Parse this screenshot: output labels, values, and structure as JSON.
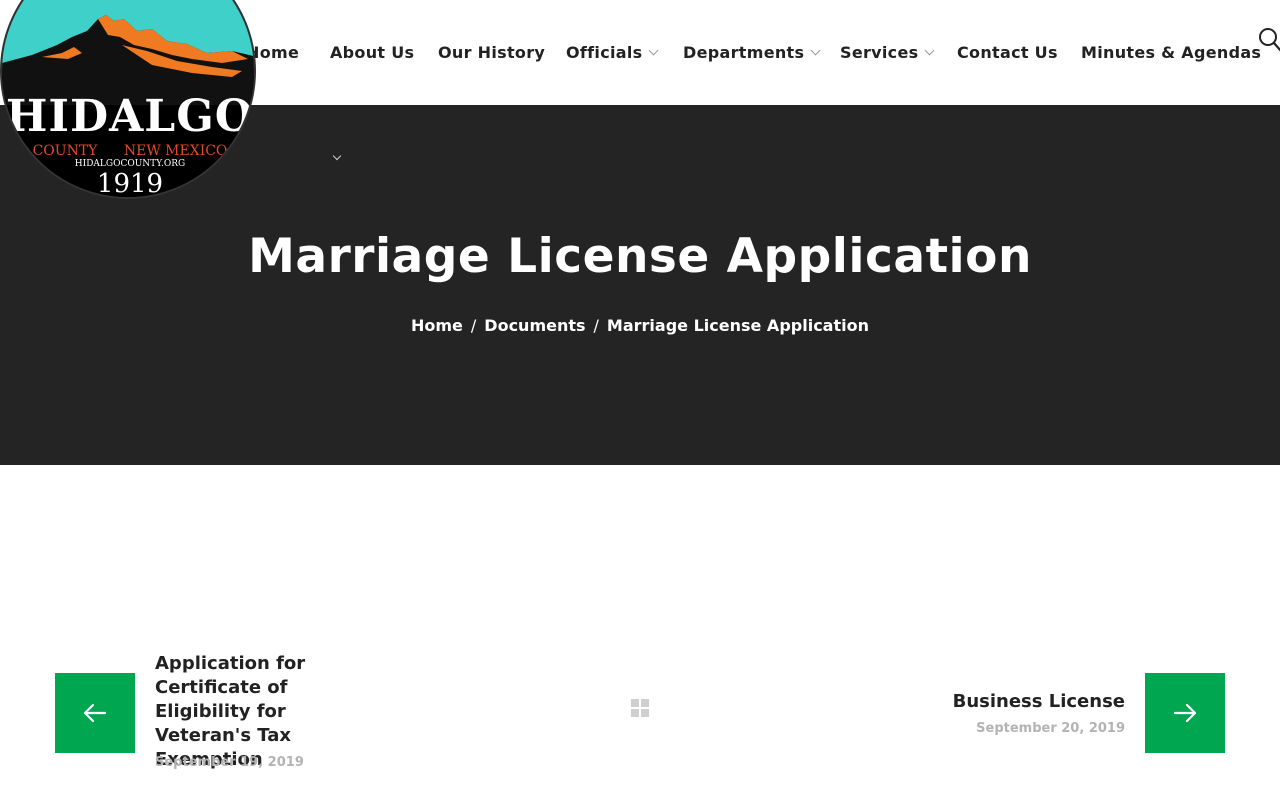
{
  "logo": {
    "name": "HIDALGO",
    "county": "COUNTY",
    "state": "NEW MEXICO",
    "website": "HIDALGOCOUNTY.ORG",
    "year": "1919"
  },
  "nav": {
    "items": [
      {
        "label": "Home"
      },
      {
        "label": "About Us"
      },
      {
        "label": "Our History"
      },
      {
        "label": "Officials"
      },
      {
        "label": "Departments"
      },
      {
        "label": "Services"
      },
      {
        "label": "Contact Us"
      },
      {
        "label": "Minutes & Agendas"
      }
    ],
    "search_icon": "search-icon"
  },
  "hero": {
    "title": "Marriage License Application",
    "breadcrumb": {
      "home": "Home",
      "separator": "/",
      "documents": "Documents",
      "current": "Marriage License Application"
    }
  },
  "post_nav": {
    "prev": {
      "title": "Application for Certificate of Eligibility for Veteran's Tax Exemption",
      "date": "September 19, 2019"
    },
    "next": {
      "title": "Business License",
      "date": "September 20, 2019"
    },
    "accent_color": "#00a650"
  },
  "colors": {
    "hero_bg": "#242424",
    "accent": "#00a650",
    "text": "#222222",
    "muted": "#b3b3b3"
  }
}
